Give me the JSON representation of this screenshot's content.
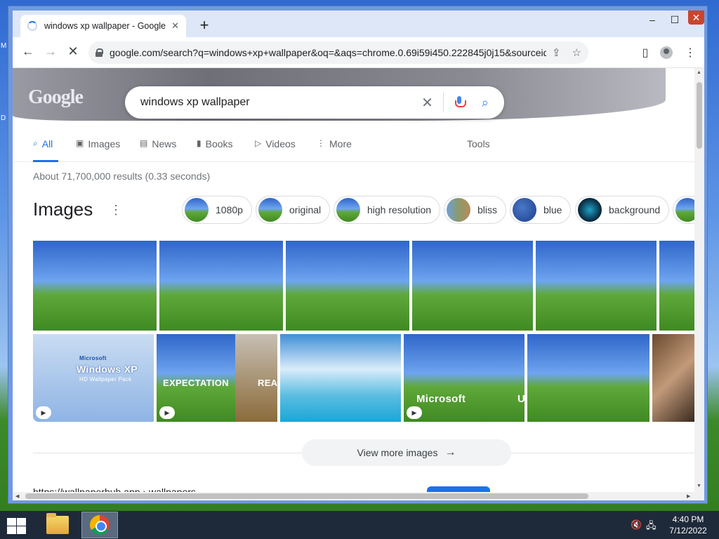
{
  "desktop": {
    "label_m": "M",
    "label_d": "D"
  },
  "browser": {
    "tab_title": "windows xp wallpaper - Google S",
    "tab_close": "✕",
    "new_tab": "+",
    "window_controls": {
      "minimize": "–",
      "maximize": "☐",
      "close": "✕"
    },
    "back": "←",
    "forward": "→",
    "stop": "✕",
    "url": "google.com/search?q=windows+xp+wallpaper&oq=&aqs=chrome.0.69i59i450.222845j0j15&sourceid=ch...",
    "share_icon": "⇪",
    "star_icon": "☆",
    "sidepanel_icon": "▯",
    "menu_icon": "⋮"
  },
  "search": {
    "logo": "Google",
    "query": "windows xp wallpaper",
    "clear": "✕",
    "search_icon": "⌕",
    "tabs": [
      {
        "label": "All",
        "icon": "⌕"
      },
      {
        "label": "Images",
        "icon": "▣"
      },
      {
        "label": "News",
        "icon": "▤"
      },
      {
        "label": "Books",
        "icon": "▮"
      },
      {
        "label": "Videos",
        "icon": "▷"
      },
      {
        "label": "More",
        "icon": "⋮"
      }
    ],
    "tools": "Tools",
    "stats": "About 71,700,000 results (0.33 seconds)"
  },
  "images": {
    "heading": "Images",
    "dots": "⋮",
    "chips": [
      "1080p",
      "original",
      "high resolution",
      "bliss",
      "blue",
      "background"
    ],
    "row2": {
      "cap1": "Windows XP",
      "cap1_sub": "HD Wallpaper Pack",
      "cap1_brand": "Microsoft",
      "cap2a": "EXPECTATION",
      "cap2b": "REA",
      "cap4": "Microsoft",
      "cap4b": "U"
    },
    "view_more": "View more images",
    "view_more_arrow": "→"
  },
  "next_result_partial": "https://wallpaperhub.app › wallpapers",
  "taskbar": {
    "time": "4:40 PM",
    "date": "7/12/2022",
    "volume_icon": "🔇",
    "network_icon": "🖧"
  }
}
